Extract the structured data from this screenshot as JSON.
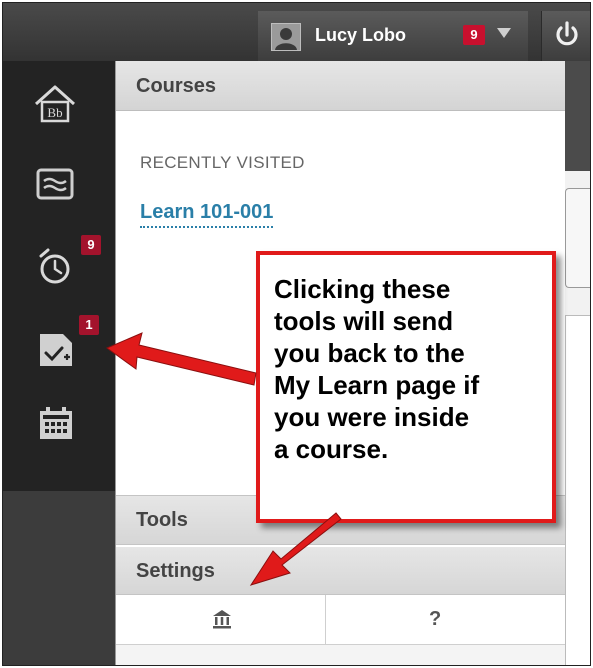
{
  "header": {
    "user_name": "Lucy Lobo",
    "notification_count": "9"
  },
  "left_nav": {
    "items": [
      {
        "icon": "blackboard-home-icon"
      },
      {
        "icon": "activity-stream-icon"
      },
      {
        "icon": "alarm-clock-icon",
        "badge": "9"
      },
      {
        "icon": "grades-icon",
        "badge": "1"
      },
      {
        "icon": "calendar-icon"
      }
    ]
  },
  "panel": {
    "title": "Courses",
    "recent_label": "RECENTLY VISITED",
    "recent_course": "Learn 101-001",
    "tools_label": "Tools",
    "settings_label": "Settings",
    "home_icon": "institution-home-icon",
    "help_label": "?"
  },
  "callout": {
    "text": "Clicking these\ntools will send\nyou back to the\nMy Learn page if\nyou were inside\na course."
  },
  "colors": {
    "callout_border": "#e01a1a",
    "badge": "#c8102e",
    "link": "#2a7fa8",
    "nav_bg": "#232323"
  }
}
